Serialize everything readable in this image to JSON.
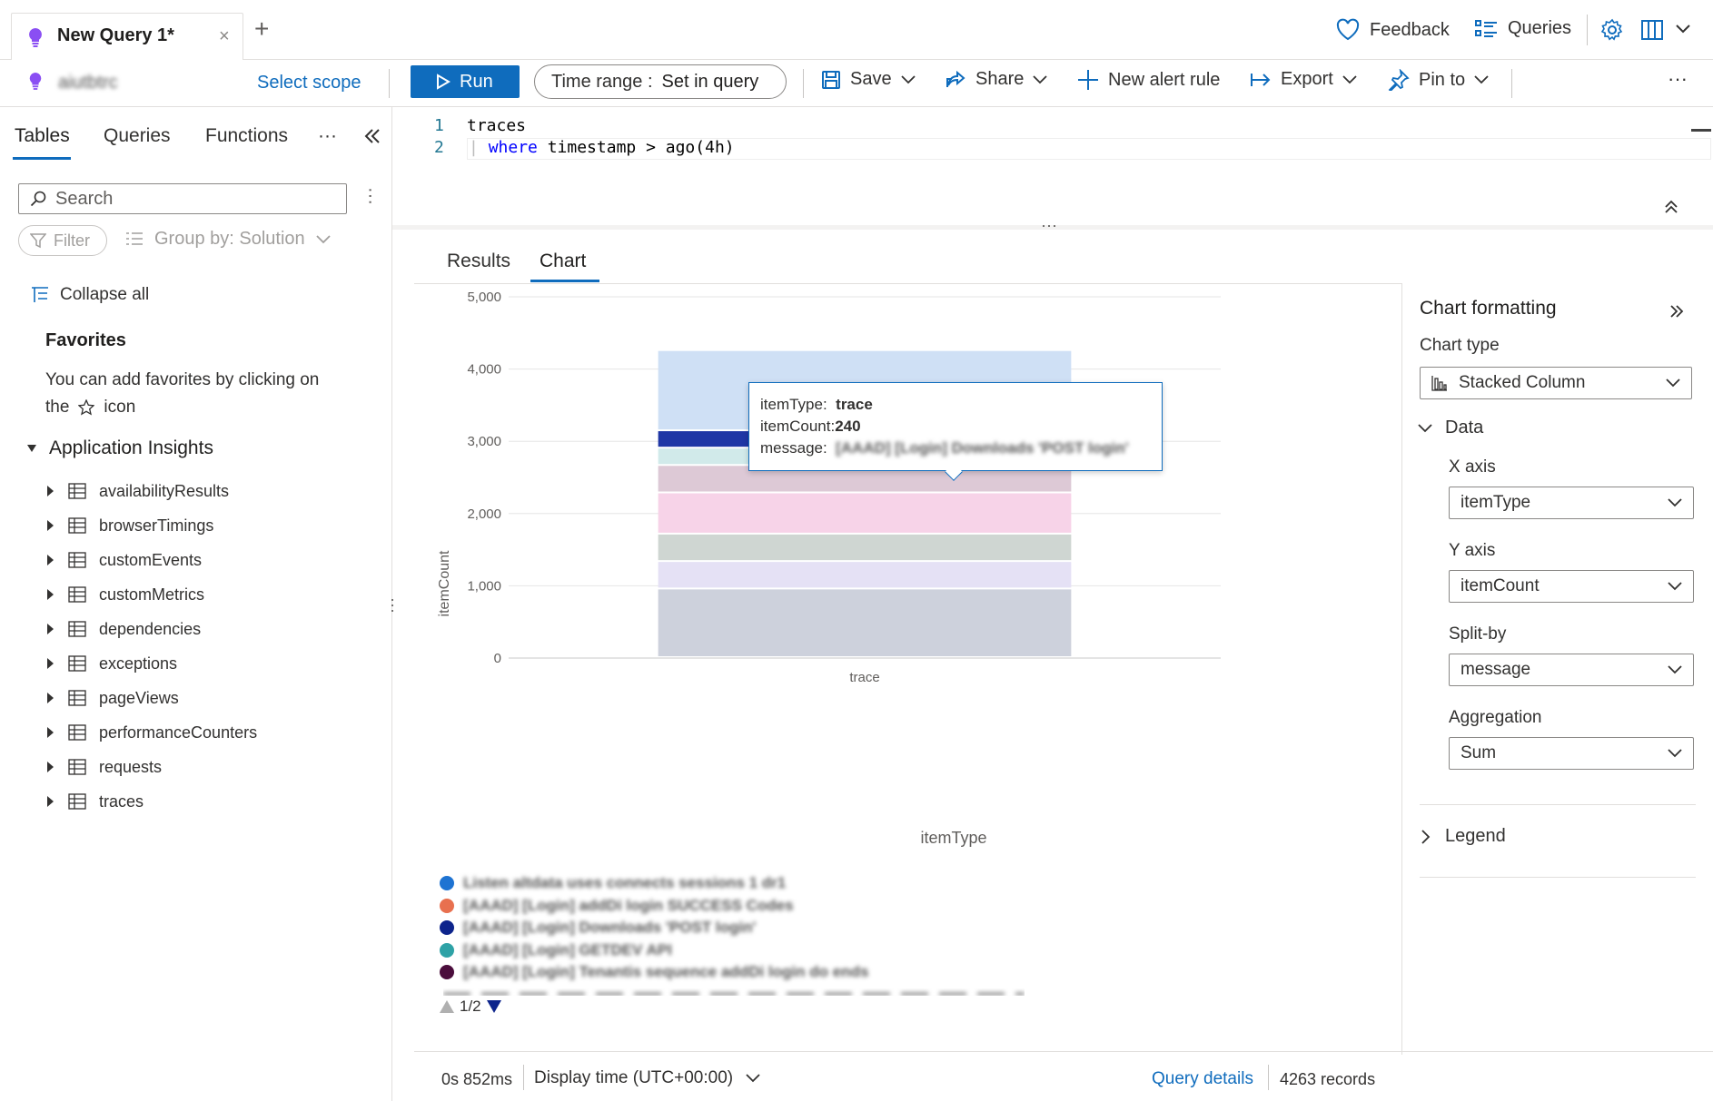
{
  "tabs": {
    "query_tab_title": "New Query 1*",
    "close_glyph": "×",
    "add_glyph": "+"
  },
  "top_actions": {
    "feedback": "Feedback",
    "queries": "Queries"
  },
  "command_bar": {
    "resource_name": "aiutbtrc",
    "select_scope": "Select scope",
    "run": "Run",
    "time_range_label": "Time range :",
    "time_range_value": "Set in query",
    "save": "Save",
    "share": "Share",
    "new_alert_rule": "New alert rule",
    "export": "Export",
    "pin_to": "Pin to",
    "more": "···"
  },
  "left_panel": {
    "tabs": [
      "Tables",
      "Queries",
      "Functions"
    ],
    "active_tab": "Tables",
    "more": "···",
    "search_placeholder": "Search",
    "filter": "Filter",
    "group_by": "Group by: Solution",
    "collapse_all": "Collapse all",
    "favorites_heading": "Favorites",
    "favorites_text_1": "You can add favorites by clicking on",
    "favorites_text_2_pre": "the",
    "favorites_text_2_post": "icon",
    "section": "Application Insights",
    "tables": [
      "availabilityResults",
      "browserTimings",
      "customEvents",
      "customMetrics",
      "dependencies",
      "exceptions",
      "pageViews",
      "performanceCounters",
      "requests",
      "traces"
    ]
  },
  "editor": {
    "line_numbers": [
      "1",
      "2"
    ],
    "line1": "traces",
    "line2_pipe": "|",
    "line2_kw": "where",
    "line2_rest": " timestamp > ago(4h)"
  },
  "results": {
    "tabs": [
      "Results",
      "Chart"
    ],
    "active_tab": "Chart"
  },
  "chart_data": {
    "type": "bar",
    "stacked": true,
    "categories": [
      "trace"
    ],
    "xlabel": "itemType",
    "ylabel": "itemCount",
    "ylim": [
      0,
      5000
    ],
    "y_ticks": [
      "0",
      "1,000",
      "2,000",
      "3,000",
      "4,000",
      "5,000"
    ],
    "grid": true,
    "series": [
      {
        "values": [
          950
        ],
        "color": "#cdd1dc"
      },
      {
        "values": [
          380
        ],
        "color": "#e5e1f5"
      },
      {
        "values": [
          380
        ],
        "color": "#cfd6d2"
      },
      {
        "values": [
          570
        ],
        "color": "#f7d3e8"
      },
      {
        "values": [
          380
        ],
        "color": "#ddc9d6"
      },
      {
        "values": [
          240
        ],
        "color": "#d1eaea"
      },
      {
        "values": [
          240
        ],
        "color": "#1f36a5"
      },
      {
        "values": [
          1110
        ],
        "color": "#cfe0f5"
      }
    ],
    "tooltip": {
      "itemType_label": "itemType:",
      "itemType_value": "trace",
      "itemCount_label": "itemCount:",
      "itemCount_value": "240",
      "message_label": "message:",
      "message_value": "[AAAD] [Login] Downloads 'POST login'"
    },
    "legend": [
      {
        "text": "Listen altdata uses connects sessions 1 dr1",
        "color": "#1e73d2"
      },
      {
        "text": "[AAAD] [Login] addDi login SUCCESS Codes",
        "color": "#e8704f"
      },
      {
        "text": "[AAAD] [Login] Downloads 'POST login'",
        "color": "#0d248c"
      },
      {
        "text": "[AAAD] [Login] GETDEV API",
        "color": "#2ea2a6"
      },
      {
        "text": "[AAAD] [Login] Tenantis sequence addDi login do ends",
        "color": "#4b0d3c"
      }
    ],
    "legend_page": "1/2"
  },
  "status": {
    "duration": "0s 852ms",
    "display_time": "Display time (UTC+00:00)",
    "query_details": "Query details",
    "records": "4263 records"
  },
  "formatting": {
    "title": "Chart formatting",
    "chart_type_label": "Chart type",
    "chart_type_value": "Stacked Column",
    "data_section": "Data",
    "x_axis_label": "X axis",
    "x_axis_value": "itemType",
    "y_axis_label": "Y axis",
    "y_axis_value": "itemCount",
    "split_by_label": "Split-by",
    "split_by_value": "message",
    "aggregation_label": "Aggregation",
    "aggregation_value": "Sum",
    "legend_section": "Legend"
  },
  "colors": {
    "accent": "#0f6cbd",
    "bulb_purple": "#8a4ef3"
  }
}
